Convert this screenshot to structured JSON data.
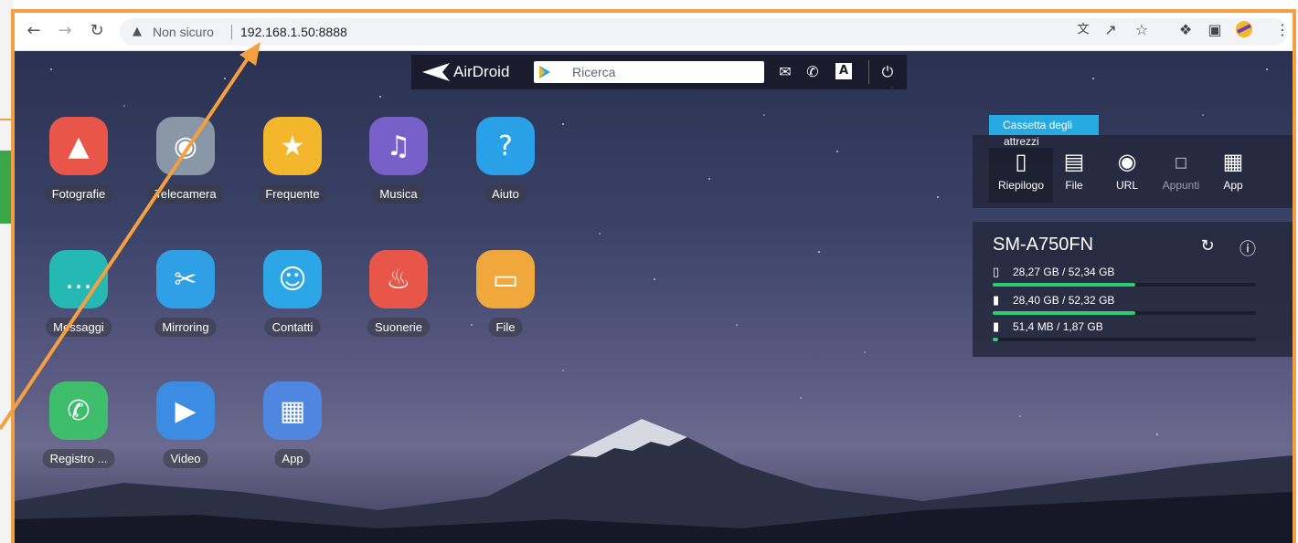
{
  "browser": {
    "security_label": "Non sicuro",
    "url": "192.168.1.50:8888",
    "icons": [
      "back-icon",
      "forward-icon",
      "reload-icon",
      "warning-icon",
      "translate-icon",
      "share-icon",
      "star-icon",
      "extensions-icon",
      "sidepanel-icon",
      "profile-icon",
      "menu-icon"
    ]
  },
  "airdroid": {
    "logo_text": "AirDroid",
    "search_placeholder": "Ricerca",
    "icons": [
      "messages-icon",
      "phone-icon",
      "font-icon",
      "power-icon"
    ]
  },
  "apps": [
    {
      "label": "Fotografie",
      "icon": "photos-icon",
      "color": "#e8564a"
    },
    {
      "label": "Telecamera",
      "icon": "camera-icon",
      "color": "#8a97a7"
    },
    {
      "label": "Frequente",
      "icon": "frequent-icon",
      "color": "#f3b62c"
    },
    {
      "label": "Musica",
      "icon": "music-icon",
      "color": "#7860c9"
    },
    {
      "label": "Aiuto",
      "icon": "help-icon",
      "color": "#2aa0e8"
    },
    {
      "label": "Messaggi",
      "icon": "message-icon",
      "color": "#26b8b2"
    },
    {
      "label": "Mirroring",
      "icon": "scissors-icon",
      "color": "#2f9fe6"
    },
    {
      "label": "Contatti",
      "icon": "contacts-icon",
      "color": "#2da6e8"
    },
    {
      "label": "Suonerie",
      "icon": "bell-icon",
      "color": "#e8564a"
    },
    {
      "label": "File",
      "icon": "folder-icon",
      "color": "#f0a73c"
    },
    {
      "label": "Registro ...",
      "icon": "call-log-icon",
      "color": "#3ebd6d"
    },
    {
      "label": "Video",
      "icon": "video-icon",
      "color": "#3d8ce3"
    },
    {
      "label": "App",
      "icon": "apps-icon",
      "color": "#4f86e0"
    }
  ],
  "toolbox": {
    "tab_label_1": "Cassetta degli",
    "tab_label_2": "attrezzi",
    "tools": [
      {
        "label": "Riepilogo",
        "icon": "phone-device-icon"
      },
      {
        "label": "File",
        "icon": "file-icon"
      },
      {
        "label": "URL",
        "icon": "globe-icon"
      },
      {
        "label": "Appunti",
        "icon": "clipboard-icon"
      },
      {
        "label": "App",
        "icon": "app-grid-icon"
      }
    ]
  },
  "device": {
    "name": "SM-A750FN",
    "storage": [
      {
        "text": "28,27 GB / 52,34 GB",
        "icon": "phone-storage-icon",
        "fraction": 0.54
      },
      {
        "text": "28,40 GB / 52,32 GB",
        "icon": "sd-storage-icon",
        "fraction": 0.54
      },
      {
        "text": "51,4 MB / 1,87 GB",
        "icon": "sd-storage-icon",
        "fraction": 0.02
      }
    ]
  },
  "colors": {
    "annotation": "#f5a040",
    "accent": "#27a9e1",
    "progress": "#2ecc71"
  }
}
